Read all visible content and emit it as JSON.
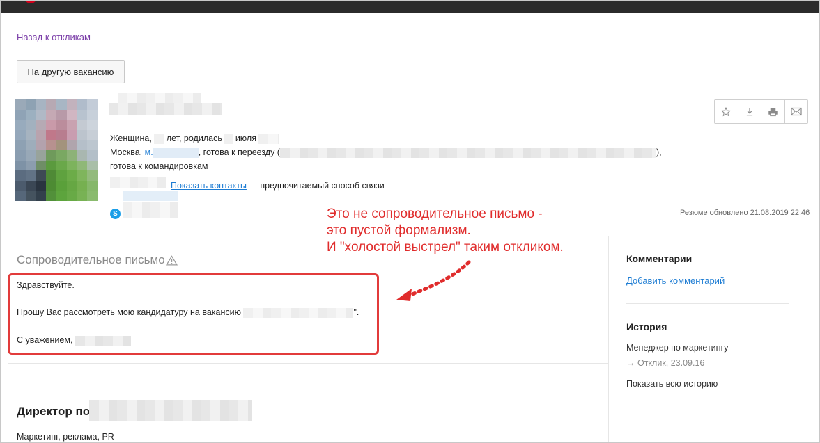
{
  "nav": {
    "back_link": "Назад к откликам",
    "other_vacancy_button": "На другую вакансию"
  },
  "profile": {
    "gender_age_prefix": "Женщина,",
    "age_suffix": "лет, родилась",
    "birth_month": "июля",
    "city": "Москва,",
    "metro_prefix": "м.",
    "relocation": ", готова к переезду (",
    "relocation_end": "),",
    "business_trips": "готова к командировкам",
    "show_contacts_link": "Показать контакты",
    "preferred_contact": "— предпочитаемый способ связи",
    "skype_icon_glyph": "S",
    "updated": "Резюме обновлено 21.08.2019 22:46"
  },
  "actions": [
    {
      "name": "favorite-star-icon",
      "glyph": "☆"
    },
    {
      "name": "download-icon",
      "glyph": "⤓"
    },
    {
      "name": "print-icon",
      "glyph": "⎙"
    },
    {
      "name": "mail-icon",
      "glyph": "✉"
    }
  ],
  "cover_letter": {
    "title": "Сопроводительное письмо",
    "greeting": "Здравствуйте.",
    "body": "Прошу Вас рассмотреть мою кандидатуру на вакансию",
    "body_end": "\".",
    "signature": "С уважением,"
  },
  "annotation": {
    "line1": "Это не сопроводительное письмо -",
    "line2": "это пустой формализм.",
    "line3": "И \"холостой выстрел\" таким откликом."
  },
  "sidebar": {
    "comments_heading": "Комментарии",
    "add_comment": "Добавить комментарий",
    "history_heading": "История",
    "history_vacancy": "Менеджер по маркетингу",
    "history_event": "→ Отклик, 23.09.16",
    "show_history": "Показать всю историю"
  },
  "experience": {
    "title_prefix": "Директор по",
    "subtitle": "Маркетинг, реклама, PR"
  },
  "colors": {
    "accent_link": "#1d7cd3",
    "visited_link": "#7b3ea8",
    "annotation_red": "#e02c2c",
    "topbar": "#2b2b2b"
  }
}
